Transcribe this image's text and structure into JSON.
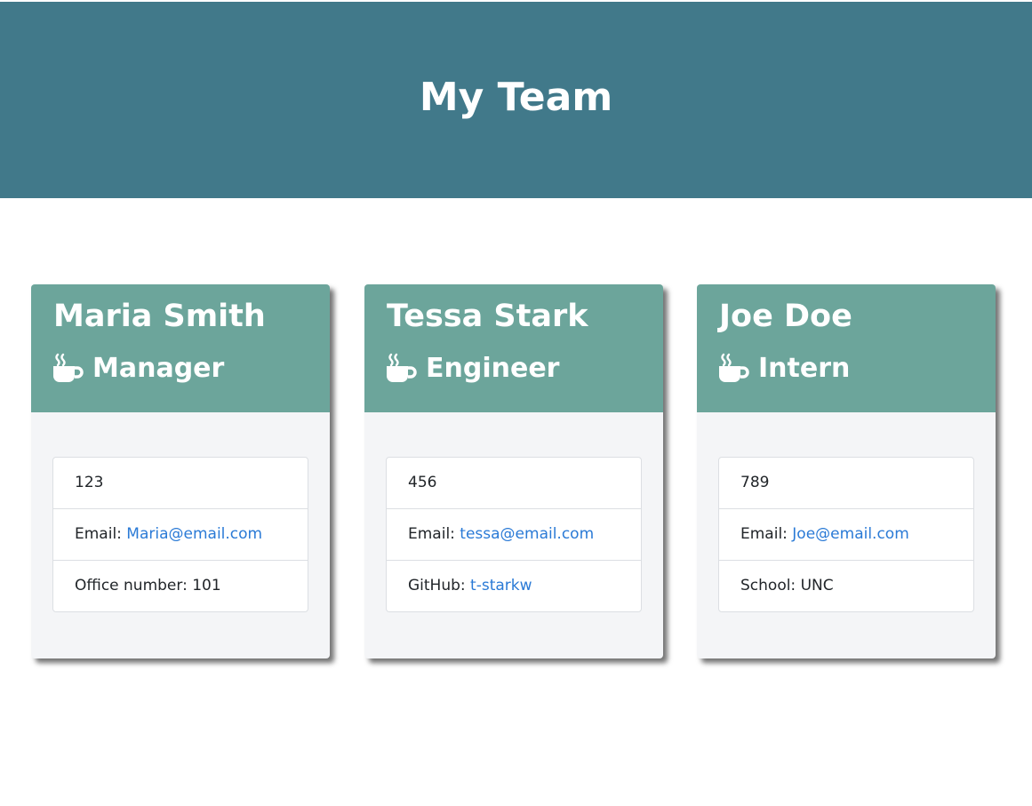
{
  "header": {
    "title": "My Team"
  },
  "icon": "coffee-mug-icon",
  "colors": {
    "jumbotron": "#41798a",
    "card_header": "#6ca59b",
    "card_body": "#f4f5f7",
    "link": "#2a7ad6"
  },
  "cards": [
    {
      "name": "Maria Smith",
      "role": "Manager",
      "id": "123",
      "email_label": "Email: ",
      "email": "Maria@email.com",
      "extra_label": "Office number: ",
      "extra_value": "101"
    },
    {
      "name": "Tessa Stark",
      "role": "Engineer",
      "id": "456",
      "email_label": "Email: ",
      "email": "tessa@email.com",
      "extra_label": "GitHub: ",
      "extra_value": "t-starkw"
    },
    {
      "name": "Joe Doe",
      "role": "Intern",
      "id": "789",
      "email_label": "Email: ",
      "email": "Joe@email.com",
      "extra_label": "School: ",
      "extra_value": "UNC"
    }
  ]
}
